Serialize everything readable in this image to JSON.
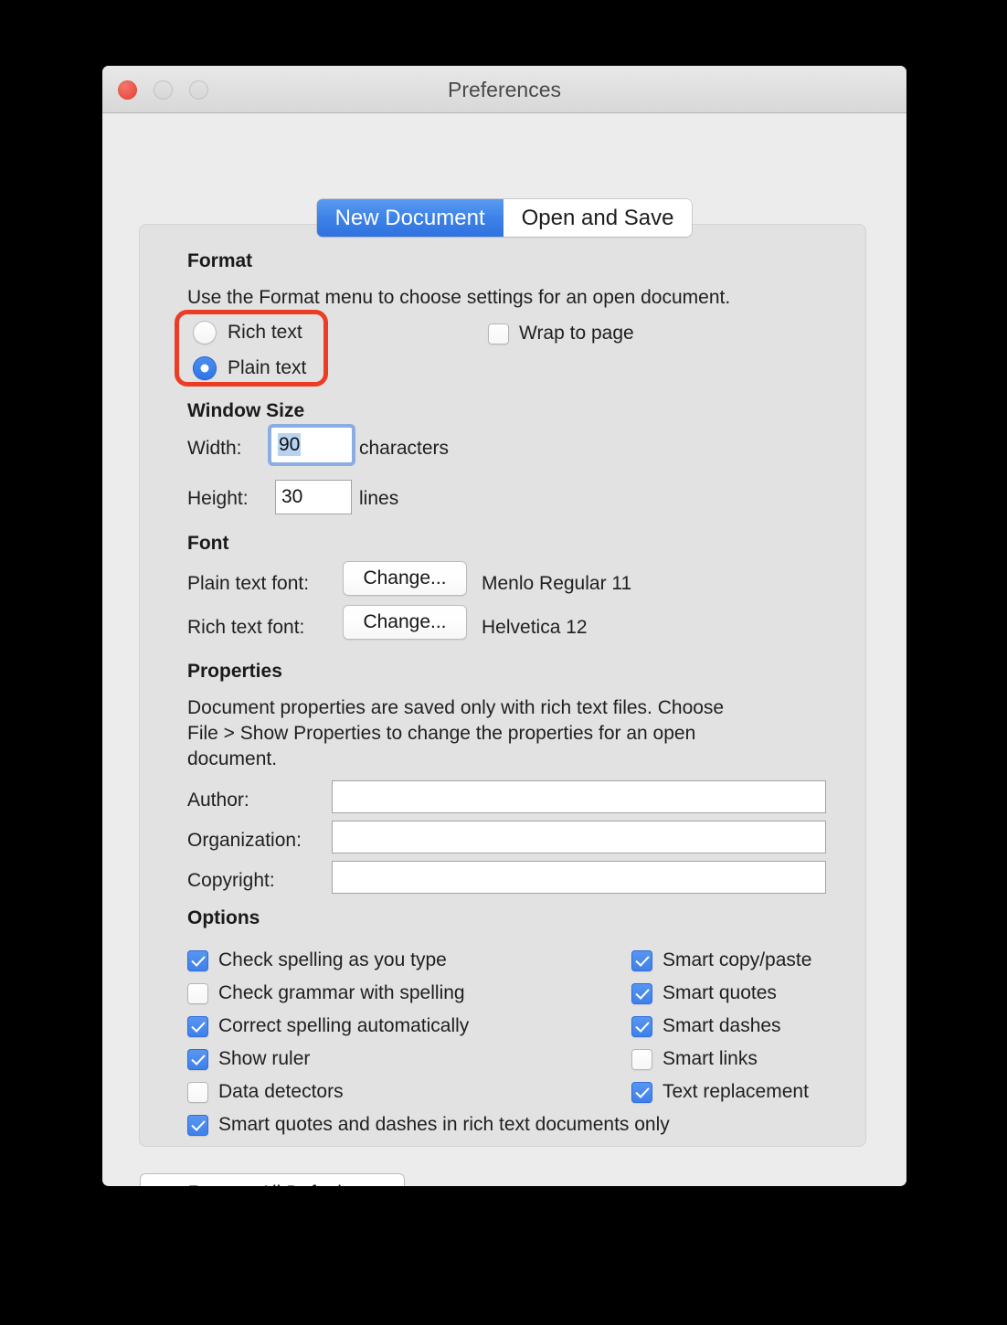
{
  "window": {
    "title": "Preferences",
    "controls": {
      "close": "close-button",
      "minimize": "minimize-button",
      "zoom": "zoom-button"
    }
  },
  "tabs": [
    {
      "label": "New Document",
      "active": true
    },
    {
      "label": "Open and Save",
      "active": false
    }
  ],
  "format": {
    "heading": "Format",
    "description": "Use the Format menu to choose settings for an open document.",
    "radios": [
      {
        "label": "Rich text",
        "selected": false
      },
      {
        "label": "Plain text",
        "selected": true
      }
    ],
    "wrap_to_page": {
      "label": "Wrap to page",
      "checked": false
    }
  },
  "window_size": {
    "heading": "Window Size",
    "width": {
      "label": "Width:",
      "value": "90",
      "unit": "characters",
      "focused": true,
      "selected": true
    },
    "height": {
      "label": "Height:",
      "value": "30",
      "unit": "lines",
      "focused": false
    }
  },
  "font": {
    "heading": "Font",
    "plain": {
      "label": "Plain text font:",
      "button": "Change...",
      "value": "Menlo Regular 11"
    },
    "rich": {
      "label": "Rich text font:",
      "button": "Change...",
      "value": "Helvetica 12"
    }
  },
  "properties": {
    "heading": "Properties",
    "description_line1": "Document properties are saved only with rich text files. Choose",
    "description_line2": "File > Show Properties to change the properties for an open",
    "description_line3": "document.",
    "fields": [
      {
        "label": "Author:",
        "value": ""
      },
      {
        "label": "Organization:",
        "value": ""
      },
      {
        "label": "Copyright:",
        "value": ""
      }
    ]
  },
  "options": {
    "heading": "Options",
    "left_column": [
      {
        "label": "Check spelling as you type",
        "checked": true
      },
      {
        "label": "Check grammar with spelling",
        "checked": false
      },
      {
        "label": "Correct spelling automatically",
        "checked": true
      },
      {
        "label": "Show ruler",
        "checked": true
      },
      {
        "label": "Data detectors",
        "checked": false
      }
    ],
    "right_column": [
      {
        "label": "Smart copy/paste",
        "checked": true
      },
      {
        "label": "Smart quotes",
        "checked": true
      },
      {
        "label": "Smart dashes",
        "checked": true
      },
      {
        "label": "Smart links",
        "checked": false
      },
      {
        "label": "Text replacement",
        "checked": true
      }
    ],
    "full_width": {
      "label": "Smart quotes and dashes in rich text documents only",
      "checked": true
    }
  },
  "footer": {
    "restore_button": "Restore All Defaults"
  },
  "annotation": {
    "color": "#ec3c23",
    "target": "format-radio-group"
  }
}
